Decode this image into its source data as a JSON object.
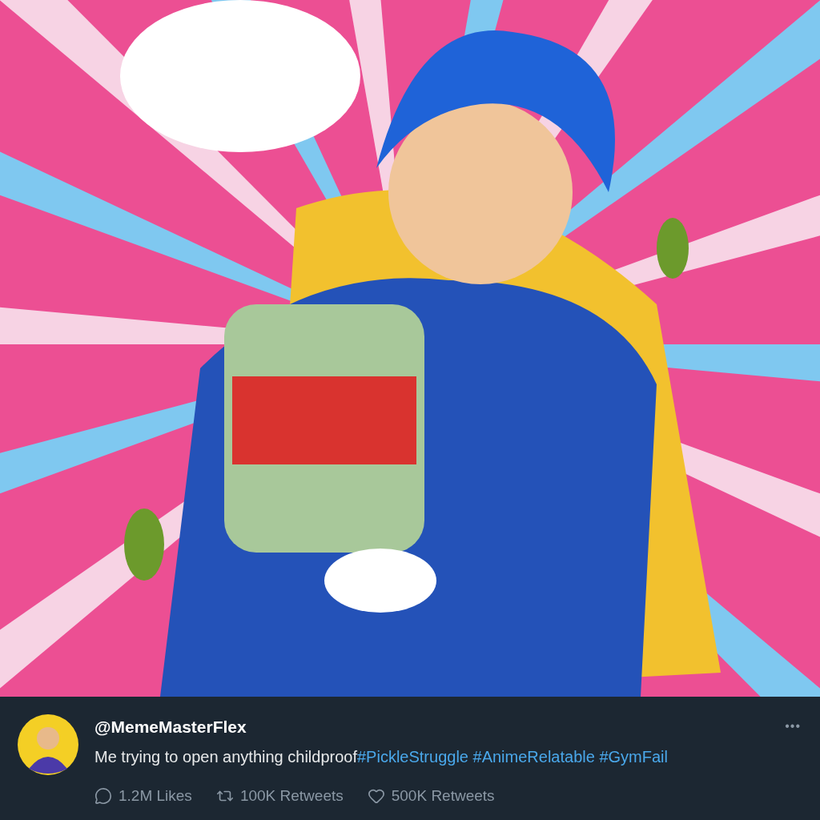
{
  "post": {
    "author": {
      "handle": "@MemeMasterFlex"
    },
    "more_menu": "•••",
    "caption": {
      "text": "Me trying to open anything childproof",
      "hashtags": [
        "#PickleStruggle",
        "#AnimeRelatable",
        "#GymFail"
      ]
    },
    "stats": [
      {
        "kind": "reply",
        "label": "1.2M Likes"
      },
      {
        "kind": "retweet",
        "label": "100K Retweets"
      },
      {
        "kind": "like",
        "label": "500K Retweets"
      }
    ]
  }
}
